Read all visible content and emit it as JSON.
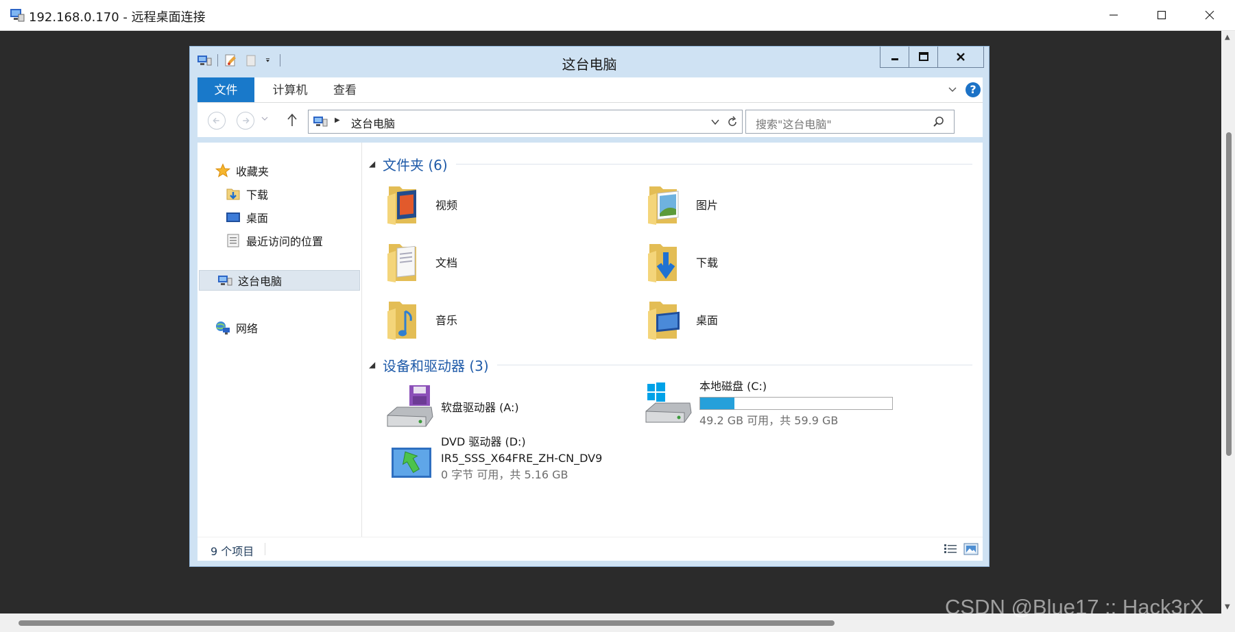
{
  "rdp": {
    "title": "192.168.0.170 - 远程桌面连接"
  },
  "explorer": {
    "title": "这台电脑",
    "ribbon_tabs": [
      "文件",
      "计算机",
      "查看"
    ],
    "help_label": "?",
    "address": "这台电脑",
    "search_placeholder": "搜索\"这台电脑\"",
    "nav": {
      "favorites": "收藏夹",
      "downloads": "下载",
      "desktop": "桌面",
      "recent": "最近访问的位置",
      "this_pc": "这台电脑",
      "network": "网络"
    },
    "folders_group": "文件夹 (6)",
    "folders": [
      {
        "label": "视频",
        "icon": "video-folder-icon"
      },
      {
        "label": "图片",
        "icon": "pictures-folder-icon"
      },
      {
        "label": "文档",
        "icon": "documents-folder-icon"
      },
      {
        "label": "下载",
        "icon": "downloads-folder-icon"
      },
      {
        "label": "音乐",
        "icon": "music-folder-icon"
      },
      {
        "label": "桌面",
        "icon": "desktop-folder-icon"
      }
    ],
    "drives_group": "设备和驱动器 (3)",
    "drives": {
      "floppy": {
        "name": "软盘驱动器 (A:)"
      },
      "c": {
        "name": "本地磁盘 (C:)",
        "free": "49.2 GB 可用，共 59.9 GB",
        "used_fraction": 0.18
      },
      "dvd": {
        "name": "DVD 驱动器 (D:)",
        "label": "IR5_SSS_X64FRE_ZH-CN_DV9",
        "free": "0 字节 可用，共 5.16 GB"
      }
    },
    "status_count": "9 个项目"
  },
  "watermark": "CSDN @Blue17 :: Hack3rX",
  "colors": {
    "accent": "#1979ca",
    "group_title": "#1e5aa8",
    "drive_bar": "#26a0da",
    "frame": "#cfe2f3"
  }
}
